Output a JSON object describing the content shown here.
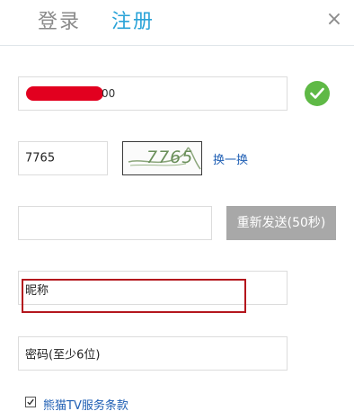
{
  "header": {
    "tab_login": "登录",
    "tab_register": "注册",
    "close_icon": "×"
  },
  "form": {
    "phone": {
      "value_suffix": "00",
      "valid_icon": "check-circle-icon"
    },
    "captcha": {
      "input_value": "7765",
      "image_text": "7765",
      "refresh_label": "换一换"
    },
    "sms": {
      "input_value": "",
      "resend_label": "重新发送(50秒)"
    },
    "nickname": {
      "placeholder": "昵称"
    },
    "password": {
      "placeholder": "密码(至少6位)"
    },
    "terms": {
      "checked": true,
      "label": "熊猫TV服务条款"
    }
  },
  "colors": {
    "accent": "#2aa3d8",
    "link": "#1f5fb4",
    "success": "#5fb946",
    "disabled_button": "#a8a8a8",
    "highlight_border": "#b4161d",
    "redaction": "#e2001f"
  }
}
